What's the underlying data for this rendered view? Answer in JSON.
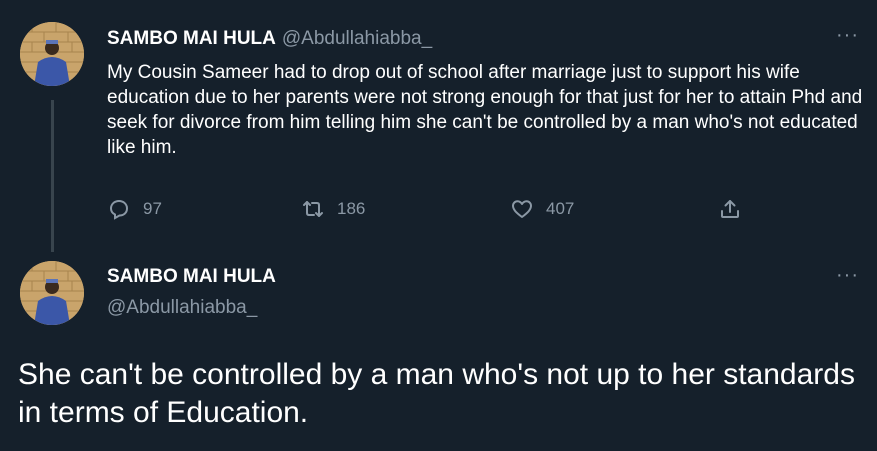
{
  "colors": {
    "background": "#15202b",
    "text_primary": "#ffffff",
    "text_secondary": "#8b98a5",
    "thread_line": "#38444d"
  },
  "tweet1": {
    "display_name": "SAMBO MAI HULA",
    "handle": "@Abdullahiabba_",
    "more_icon": "more-horizontal-icon",
    "more_glyph": "···",
    "text": "My Cousin Sameer had to drop out of school after marriage just to support his wife education due to her parents were not strong enough for that just for her to attain  Phd and seek for divorce from him telling him she can't be controlled by a man who's not educated like him.",
    "actions": {
      "replies": "97",
      "retweets": "186",
      "likes": "407",
      "reply_icon": "reply-icon",
      "retweet_icon": "retweet-icon",
      "like_icon": "heart-icon",
      "share_icon": "share-icon"
    }
  },
  "tweet2": {
    "display_name": "SAMBO MAI HULA",
    "handle": "@Abdullahiabba_",
    "more_icon": "more-horizontal-icon",
    "more_glyph": "···",
    "text": "She can't be controlled by a man who's not up to her standards in terms of Education."
  }
}
